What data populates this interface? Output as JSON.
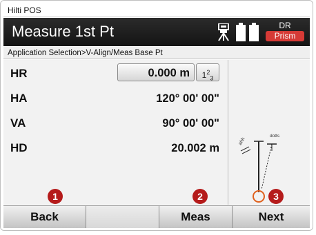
{
  "app": {
    "title": "Hilti POS"
  },
  "header": {
    "title": "Measure 1st Pt",
    "status": {
      "mode_top": "DR",
      "mode_bottom": "Prism",
      "prism_color": "#d63a36"
    }
  },
  "breadcrumb": "Application Selection>V-Align/Meas Base Pt",
  "measurements": [
    {
      "label": "HR",
      "value": "0.000 m",
      "editable": true,
      "unit_toggle": "1 2 3"
    },
    {
      "label": "HA",
      "value": "120° 00' 00\""
    },
    {
      "label": "VA",
      "value": "90° 00' 00\""
    },
    {
      "label": "HD",
      "value": "20.002 m"
    }
  ],
  "diagram": {
    "note": "dotts",
    "icons": [
      "tripod-icon",
      "pole-icon"
    ]
  },
  "markers": [
    "1",
    "2",
    "3"
  ],
  "softkeys": {
    "back": "Back",
    "meas": "Meas",
    "next": "Next"
  }
}
